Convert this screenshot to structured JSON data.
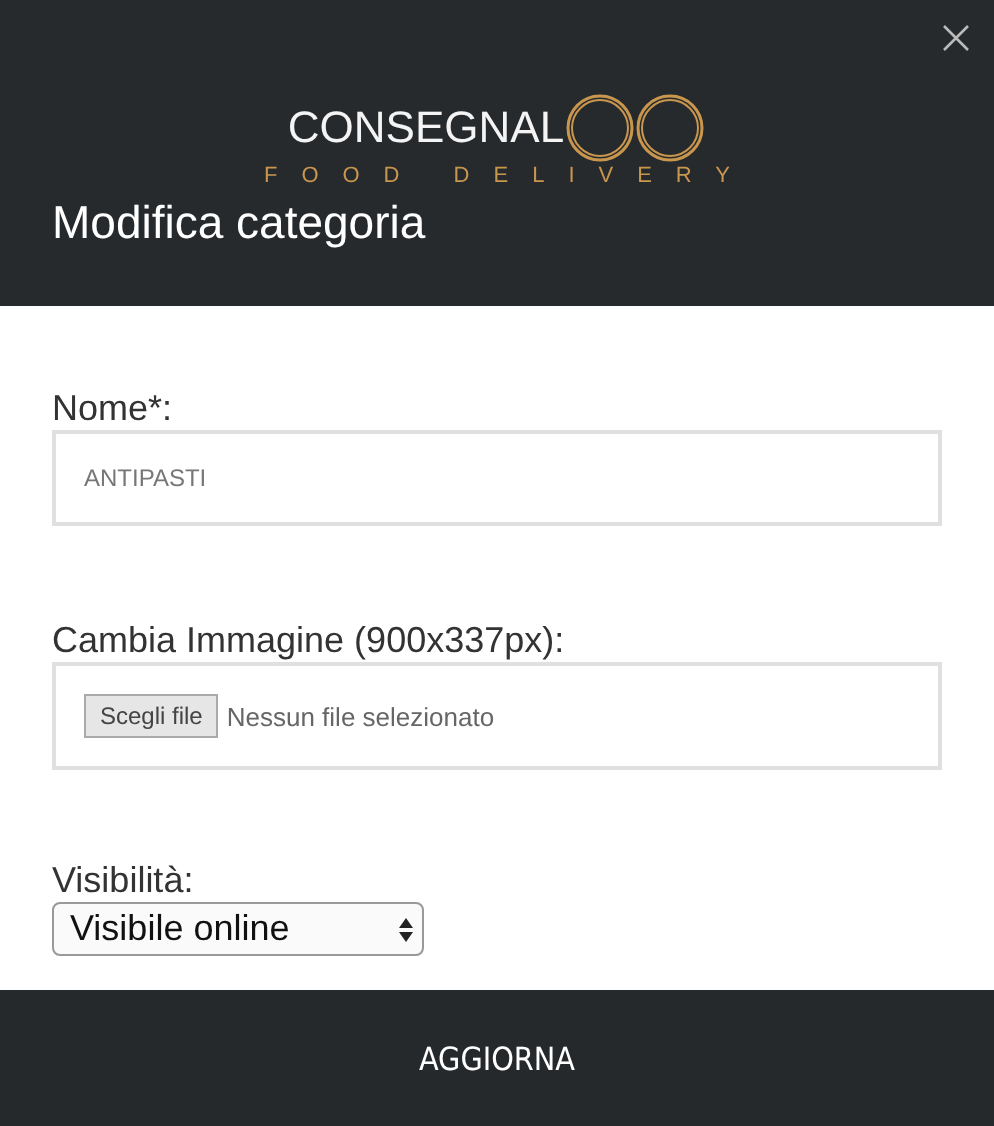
{
  "header": {
    "logo_text": "CONSEGNAL",
    "logo_tagline": "FOOD DELIVERY",
    "title": "Modifica categoria"
  },
  "form": {
    "name_label": "Nome*:",
    "name_value": "ANTIPASTI",
    "image_label": "Cambia Immagine (900x337px):",
    "file_button": "Scegli file",
    "file_status": "Nessun file selezionato",
    "visibility_label": "Visibilità:",
    "visibility_value": "Visibile online"
  },
  "footer": {
    "submit": "AGGIORNA"
  }
}
